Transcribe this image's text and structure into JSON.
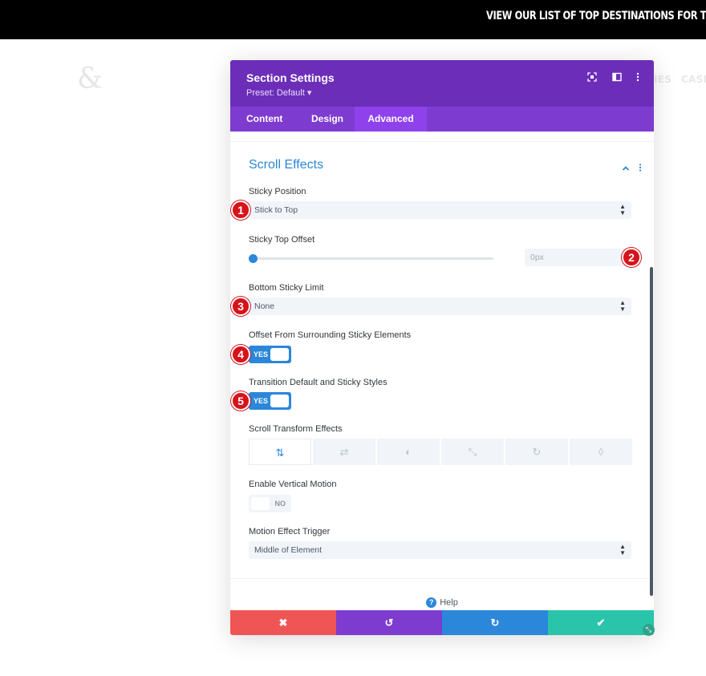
{
  "background": {
    "topbar_text": "VIEW OUR LIST OF TOP DESTINATIONS FOR THIS Y",
    "logo_glyph": "&",
    "nav_items": [
      "IES",
      "CASE"
    ]
  },
  "modal": {
    "title": "Section Settings",
    "preset": "Preset: Default ▾",
    "header_icons": [
      "focus-icon",
      "split-view-icon",
      "more-options-icon"
    ],
    "tabs": [
      {
        "label": "Content",
        "active": false
      },
      {
        "label": "Design",
        "active": false
      },
      {
        "label": "Advanced",
        "active": true
      }
    ],
    "section_title": "Scroll Effects",
    "fields": {
      "sticky_position": {
        "label": "Sticky Position",
        "value": "Stick to Top"
      },
      "sticky_top_offset": {
        "label": "Sticky Top Offset",
        "placeholder": "0px",
        "slider_value": 0
      },
      "bottom_sticky_limit": {
        "label": "Bottom Sticky Limit",
        "value": "None"
      },
      "offset_surrounding": {
        "label": "Offset From Surrounding Sticky Elements",
        "toggle": "YES"
      },
      "transition_styles": {
        "label": "Transition Default and Sticky Styles",
        "toggle": "YES"
      },
      "scroll_transform": {
        "label": "Scroll Transform Effects",
        "buttons": [
          {
            "icon": "vertical-motion-icon",
            "glyph": "⇅",
            "active": true
          },
          {
            "icon": "horizontal-motion-icon",
            "glyph": "⇄",
            "active": false
          },
          {
            "icon": "fading-icon",
            "glyph": "◐",
            "active": false
          },
          {
            "icon": "scaling-icon",
            "glyph": "⤡",
            "active": false
          },
          {
            "icon": "rotating-icon",
            "glyph": "↻",
            "active": false
          },
          {
            "icon": "blur-icon",
            "glyph": "◊",
            "active": false
          }
        ]
      },
      "vertical_motion": {
        "label": "Enable Vertical Motion",
        "toggle": "NO"
      },
      "motion_trigger": {
        "label": "Motion Effect Trigger",
        "value": "Middle of Element"
      }
    },
    "help_label": "Help",
    "footer": {
      "cancel_glyph": "✖",
      "undo_glyph": "↺",
      "redo_glyph": "↻",
      "save_glyph": "✔",
      "colors": {
        "cancel": "#ef5555",
        "undo": "#7e3bd0",
        "redo": "#2b87da",
        "save": "#29c4a9"
      }
    }
  },
  "annotations": [
    "1",
    "2",
    "3",
    "4",
    "5"
  ],
  "colors": {
    "header": "#6c2eb9",
    "tabs": "#7e3bd0",
    "accent": "#2b87da",
    "badge": "#d7131a"
  }
}
